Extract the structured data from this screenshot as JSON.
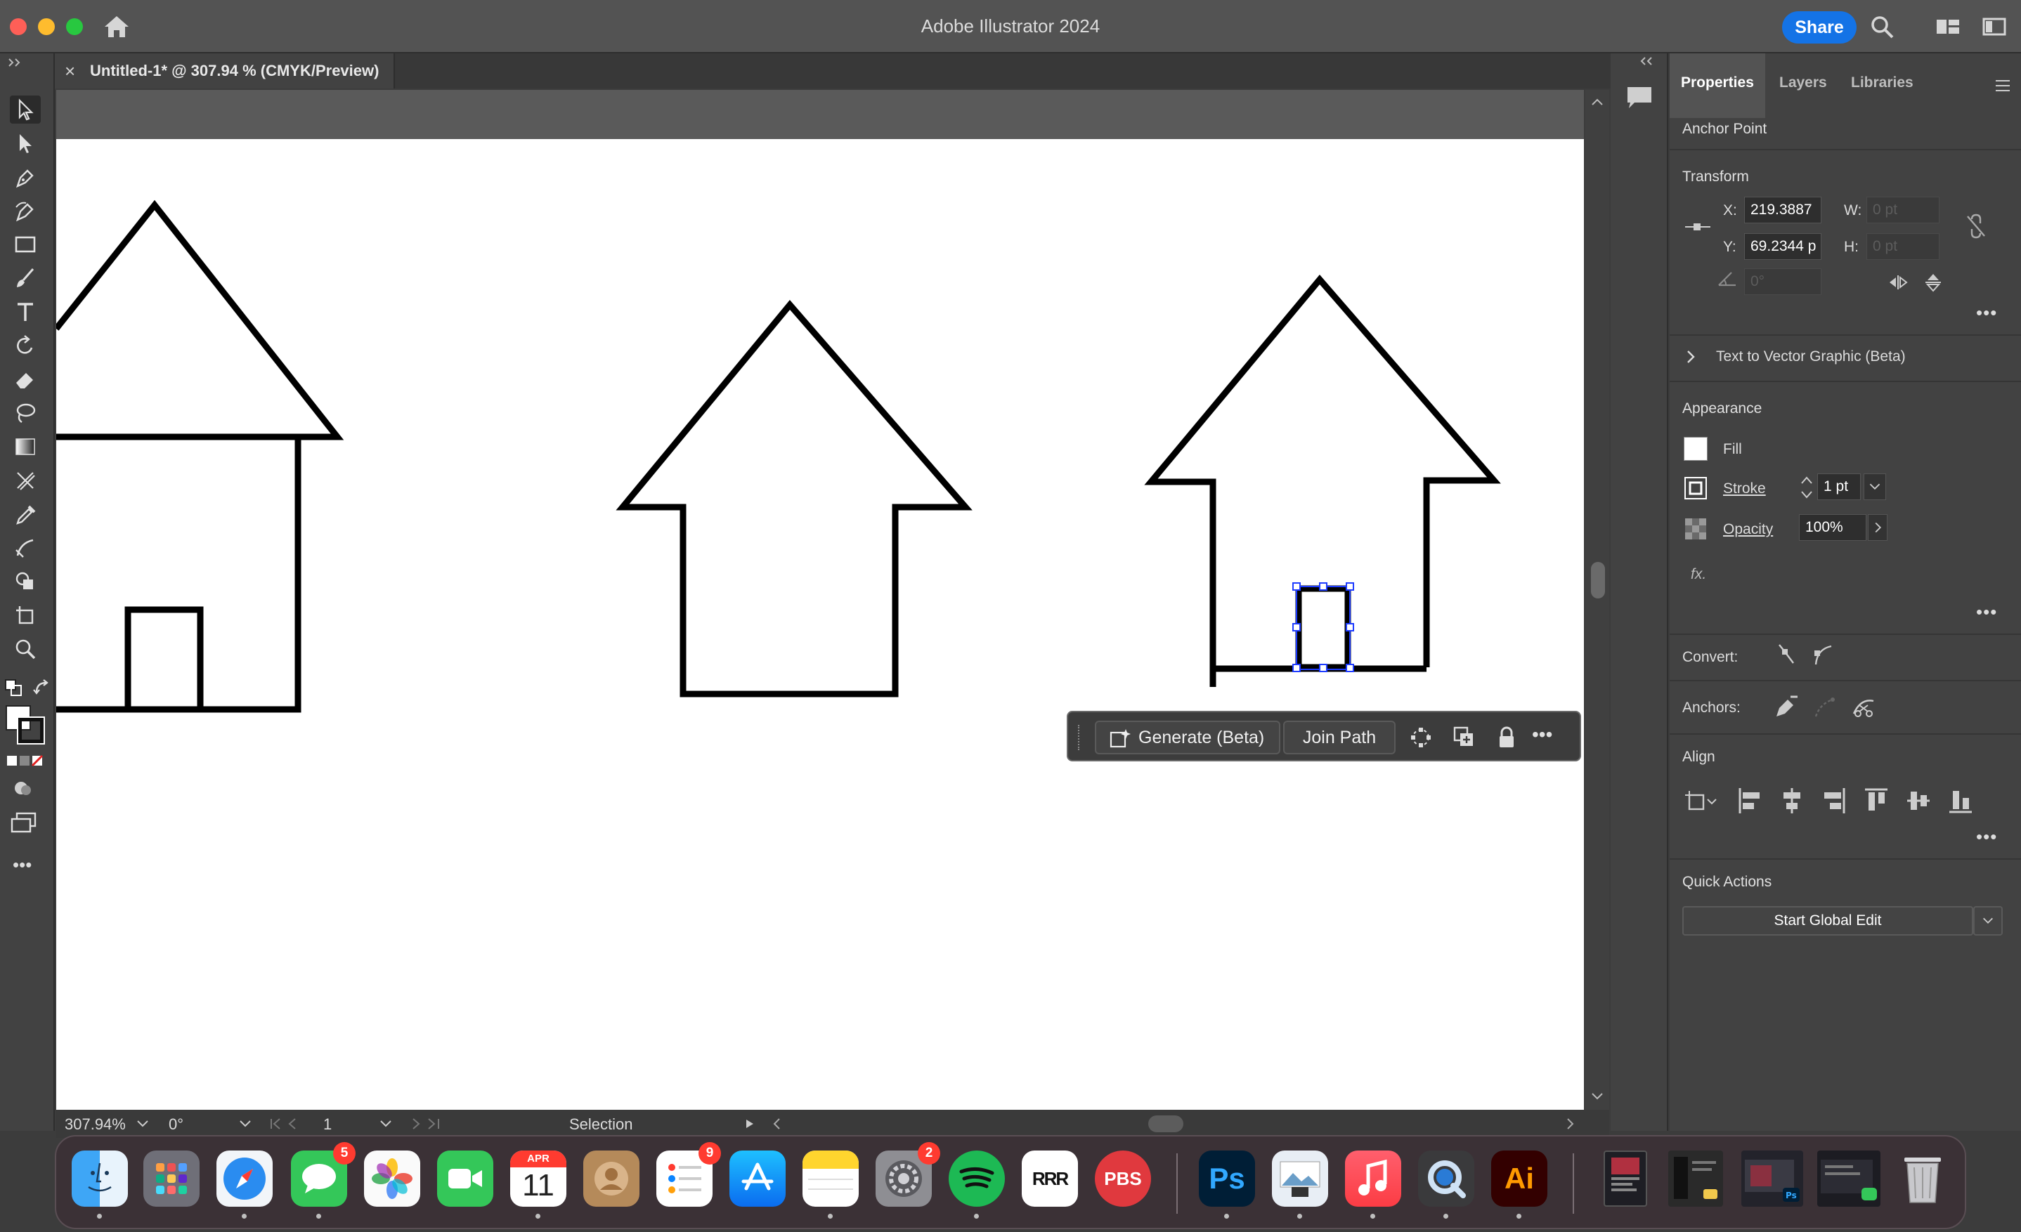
{
  "window": {
    "title": "Adobe Illustrator 2024",
    "share_label": "Share"
  },
  "document": {
    "tab_title": "Untitled-1* @ 307.94 % (CMYK/Preview)",
    "close_glyph": "×"
  },
  "status_bar": {
    "zoom": "307.94%",
    "rotation": "0°",
    "artboard_number": "1",
    "tool_status": "Selection"
  },
  "context_task_bar": {
    "generate_label": "Generate (Beta)",
    "join_path_label": "Join Path",
    "more_glyph": "•••"
  },
  "panel": {
    "tabs": [
      "Properties",
      "Layers",
      "Libraries"
    ],
    "selection_type": "Anchor Point",
    "transform": {
      "heading": "Transform",
      "x_label": "X:",
      "x_value": "219.3887",
      "y_label": "Y:",
      "y_value": "69.2344 p",
      "w_label": "W:",
      "w_value": "0 pt",
      "h_label": "H:",
      "h_value": "0 pt",
      "angle_value": "0°"
    },
    "text_to_vector": "Text to Vector Graphic (Beta)",
    "appearance": {
      "heading": "Appearance",
      "fill_label": "Fill",
      "stroke_label": "Stroke",
      "stroke_weight": "1 pt",
      "opacity_label": "Opacity",
      "opacity_value": "100%",
      "fx_label": "fx."
    },
    "convert_label": "Convert:",
    "anchors_label": "Anchors:",
    "align_heading": "Align",
    "quick_actions": {
      "heading": "Quick Actions",
      "global_edit": "Start Global Edit"
    }
  },
  "colors": {
    "accent": "#1473e6",
    "selection": "#1e3cff",
    "badge": "#ff3b30"
  },
  "dock": {
    "badges": {
      "messages": "5",
      "reminders": "9",
      "system_settings": "2"
    },
    "calendar_month": "APR",
    "calendar_day": "11",
    "photoshop_label": "Ps",
    "illustrator_label": "Ai",
    "rrr_label": "RRR",
    "pbs_label": "PBS",
    "icons": [
      "finder-icon",
      "launchpad-icon",
      "safari-icon",
      "messages-icon",
      "photos-icon",
      "facetime-icon",
      "calendar-icon",
      "contacts-icon",
      "reminders-icon",
      "app-store-icon",
      "notes-icon",
      "system-settings-icon",
      "spotify-icon",
      "rrr-icon",
      "pbs-icon",
      "photoshop-icon",
      "preview-icon",
      "music-icon",
      "quicktime-icon",
      "illustrator-icon",
      "trash-icon"
    ]
  }
}
